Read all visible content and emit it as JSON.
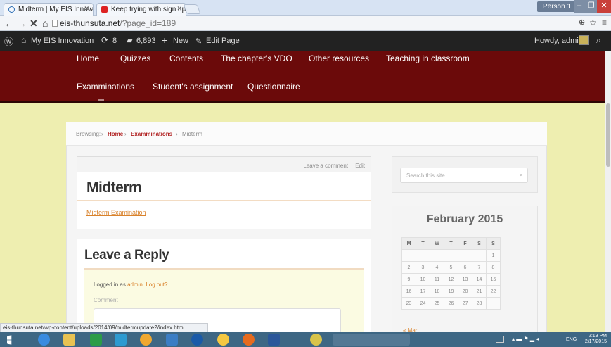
{
  "browser": {
    "tabs": [
      {
        "label": "Midterm | My EIS Innovati"
      },
      {
        "label": "Keep trying with sign up t"
      }
    ],
    "person": "Person 1",
    "url_host": "eis-thunsuta.net",
    "url_path": "/?page_id=189"
  },
  "wp_admin": {
    "site": "My EIS Innovation",
    "updates": "8",
    "comments": "6,893",
    "new": "New",
    "edit_page": "Edit Page",
    "howdy": "Howdy, admin"
  },
  "menu": {
    "row1": [
      "Home",
      "Quizzes",
      "Contents",
      "The chapter's VDO",
      "Other resources",
      "Teaching in classroom"
    ],
    "row2": [
      "Examminations",
      "Student's assignment",
      "Questionnaire"
    ]
  },
  "breadcrumb": {
    "browsing": "Browsing:",
    "home": "Home",
    "section": "Examminations",
    "current": "Midterm"
  },
  "post": {
    "leave_comment": "Leave a comment",
    "edit": "Edit",
    "title": "Midterm",
    "link_text": "Midterm Examination"
  },
  "reply": {
    "title": "Leave a Reply",
    "logged_in_prefix": "Logged in as",
    "admin_link": "admin.",
    "logout_link": "Log out?",
    "comment_label": "Comment"
  },
  "sidebar": {
    "search_placeholder": "Search this site...",
    "calendar_title": "February 2015",
    "weekdays": [
      "M",
      "T",
      "W",
      "T",
      "F",
      "S",
      "S"
    ],
    "weeks": [
      [
        "",
        "",
        "",
        "",
        "",
        "",
        "1"
      ],
      [
        "2",
        "3",
        "4",
        "5",
        "6",
        "7",
        "8"
      ],
      [
        "9",
        "10",
        "11",
        "12",
        "13",
        "14",
        "15"
      ],
      [
        "16",
        "17",
        "18",
        "19",
        "20",
        "21",
        "22"
      ],
      [
        "23",
        "24",
        "25",
        "26",
        "27",
        "28",
        ""
      ]
    ],
    "prev_link": "« Mar"
  },
  "status_url": "eis-thunsuta.net/wp-content/uploads/2014/09/midtermupdate2/index.html",
  "taskbar": {
    "lang": "ENG",
    "time": "2:19 PM",
    "date": "2/17/2015"
  },
  "colors": {
    "menu_bg": "#6b0a0a",
    "page_bg": "#eeeeb0",
    "accent_red": "#b02020",
    "link_orange": "#d9822b"
  }
}
